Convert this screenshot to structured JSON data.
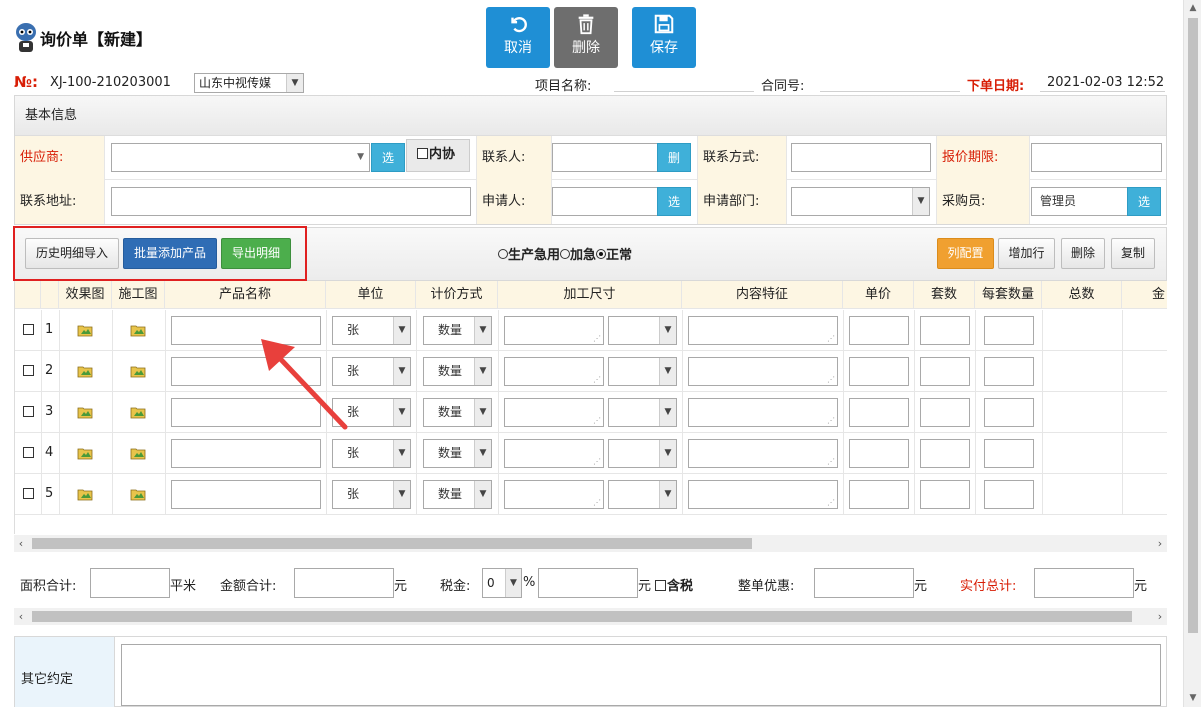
{
  "header": {
    "title": "询价单【新建】",
    "buttons": {
      "cancel": "取消",
      "delete": "删除",
      "save": "保存"
    }
  },
  "order": {
    "no_label": "№:",
    "no_value": "XJ-100-210203001",
    "company": "山东中视传媒",
    "project_label": "项目名称:",
    "contract_label": "合同号:",
    "order_date_label": "下单日期:",
    "order_date": "2021-02-03 12:52"
  },
  "basic": {
    "title": "基本信息",
    "supplier_label": "供应商:",
    "pick": "选",
    "internal": "内协",
    "contact_label": "联系人:",
    "del": "删",
    "contact_way_label": "联系方式:",
    "quote_deadline_label": "报价期限:",
    "address_label": "联系地址:",
    "applicant_label": "申请人:",
    "dept_label": "申请部门:",
    "buyer_label": "采购员:",
    "buyer_value": "管理员"
  },
  "toolbar": {
    "history_import": "历史明细导入",
    "batch_add": "批量添加产品",
    "export": "导出明细",
    "radio_urgent_prod": "生产急用",
    "radio_rush": "加急",
    "radio_normal": "正常",
    "col_config": "列配置",
    "add_row": "增加行",
    "delete": "删除",
    "copy": "复制"
  },
  "table": {
    "columns": [
      "效果图",
      "施工图",
      "产品名称",
      "单位",
      "计价方式",
      "加工尺寸",
      "内容特征",
      "单价",
      "套数",
      "每套数量",
      "总数",
      "金"
    ],
    "rows": [
      {
        "num": "1",
        "unit": "张",
        "pricing": "数量"
      },
      {
        "num": "2",
        "unit": "张",
        "pricing": "数量"
      },
      {
        "num": "3",
        "unit": "张",
        "pricing": "数量"
      },
      {
        "num": "4",
        "unit": "张",
        "pricing": "数量"
      },
      {
        "num": "5",
        "unit": "张",
        "pricing": "数量"
      }
    ]
  },
  "totals": {
    "area_label": "面积合计:",
    "area_unit": "平米",
    "amount_label": "金额合计:",
    "yuan": "元",
    "tax_label": "税金:",
    "tax_rate": "0",
    "percent": "%",
    "tax_incl": "含税",
    "discount_label": "整单优惠:",
    "actual_label": "实付总计:"
  },
  "other": {
    "label": "其它约定"
  },
  "colors": {
    "red": "#d81e06",
    "blue": "#1f8fd5",
    "gray": "#6e6e6e",
    "highlight": "#e02020"
  }
}
